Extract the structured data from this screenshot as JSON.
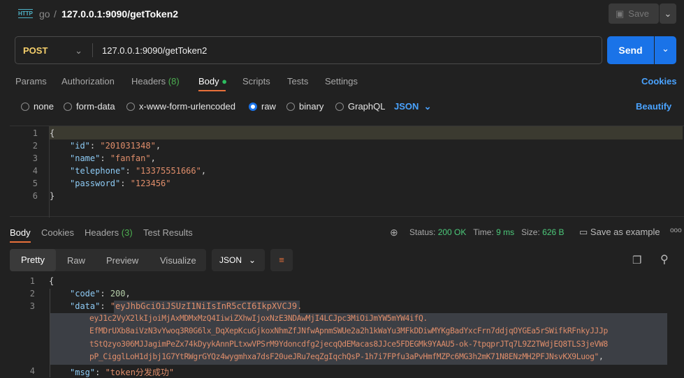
{
  "header": {
    "icon": "http-icon",
    "collection": "go",
    "separator": "/",
    "title": "127.0.0.1:9090/getToken2",
    "save_label": "Save"
  },
  "request": {
    "method": "POST",
    "url": "127.0.0.1:9090/getToken2",
    "send_label": "Send"
  },
  "req_tabs": [
    {
      "label": "Params"
    },
    {
      "label": "Authorization"
    },
    {
      "label": "Headers",
      "count": "(8)"
    },
    {
      "label": "Body"
    },
    {
      "label": "Scripts"
    },
    {
      "label": "Tests"
    },
    {
      "label": "Settings"
    }
  ],
  "cookies_label": "Cookies",
  "body_types": [
    "none",
    "form-data",
    "x-www-form-urlencoded",
    "raw",
    "binary",
    "GraphQL"
  ],
  "body_selected": "raw",
  "format": "JSON",
  "beautify": "Beautify",
  "request_body": {
    "line_numbers": [
      "1",
      "2",
      "3",
      "4",
      "5",
      "6"
    ],
    "open": "{",
    "close": "}",
    "fields": [
      {
        "key": "\"id\"",
        "value": "\"201031348\"",
        "comma": ","
      },
      {
        "key": "\"name\"",
        "value": "\"fanfan\"",
        "comma": ","
      },
      {
        "key": "\"telephone\"",
        "value": "\"13375551666\"",
        "comma": ","
      },
      {
        "key": "\"password\"",
        "value": "\"123456\"",
        "comma": ""
      }
    ]
  },
  "resp_tabs": [
    {
      "label": "Body"
    },
    {
      "label": "Cookies"
    },
    {
      "label": "Headers",
      "count": "(3)"
    },
    {
      "label": "Test Results"
    }
  ],
  "status": {
    "status_label": "Status:",
    "status": "200 OK",
    "time_label": "Time:",
    "time": "9 ms",
    "size_label": "Size:",
    "size": "626 B",
    "save_example": "Save as example"
  },
  "view_tabs": [
    "Pretty",
    "Raw",
    "Preview",
    "Visualize"
  ],
  "view_format": "JSON",
  "response": {
    "line_numbers": [
      "1",
      "2",
      "3",
      "4"
    ],
    "open": "{",
    "code_key": "\"code\"",
    "code_value": "200",
    "data_key": "\"data\"",
    "token_lines": [
      "eyJhbGciOiJSUzI1NiIsInR5cCI6IkpXVCJ9.",
      "eyJ1c2VyX2lkIjoiMjAxMDMxMzQ4IiwiZXhwIjoxNzE3NDAwMjI4LCJpc3MiOiJmYW5mYW4ifQ.",
      "EfMDrUXb8aiVzN3vYwoq3R0G6lx_DqXepKcuGjkoxNhmZfJNfwApnmSWUe2a2h1kWaYu3MFkDDiwMYKgBadYxcFrn7ddjqOYGEa5rSWifkRFnkyJJJp",
      "tStQzyo306MJJagimPeZx74kDyykAnnPLtxwVPSrM9Ydoncdfg2jecqQdEMacas8JJce5FDEGMk9YAAU5-ok-7tpqprJTq7L9Z2TWdjEQ8TLS3jeVW8",
      "pP_CigglLoH1djbj1G7YtRWgrGYQz4wygmhxa7dsF20ueJRu7eqZgIqchQsP-1h7i7FPfu3aPvHmfMZPc6MG3h2mK71N8ENzMH2PFJNsvKX9Luog"
    ],
    "msg_key": "\"msg\"",
    "msg_value": "\"token分发成功\""
  }
}
